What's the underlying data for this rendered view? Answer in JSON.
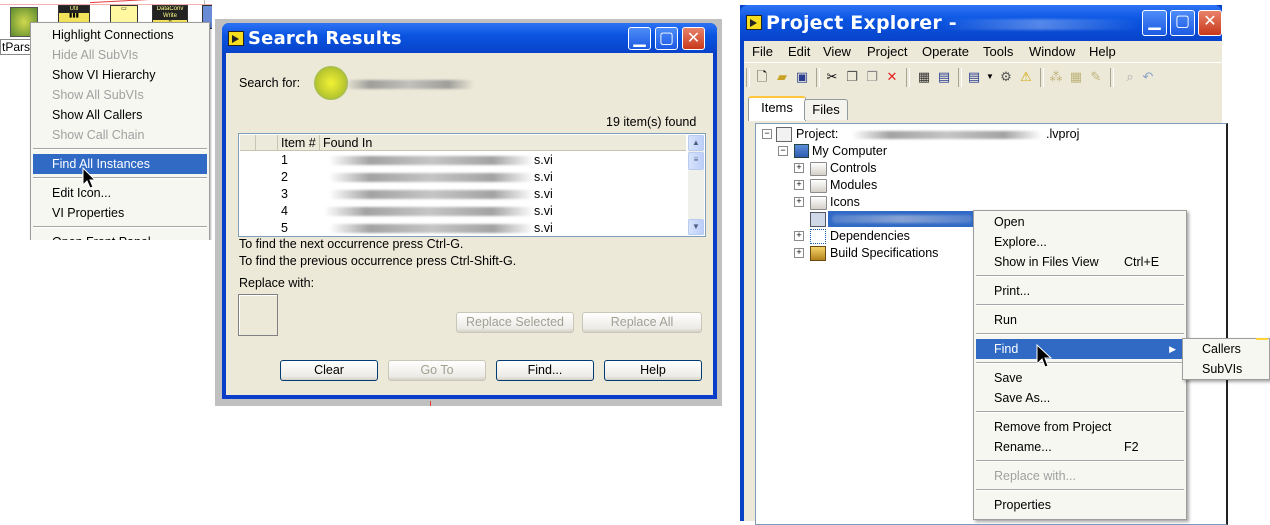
{
  "panel1": {
    "block_label": "tParse",
    "node_labels": [
      "Util",
      "DataConv Write"
    ],
    "context_menu": {
      "items": [
        {
          "label": "Highlight Connections",
          "disabled": false
        },
        {
          "label": "Hide All SubVIs",
          "disabled": true
        },
        {
          "label": "Show VI Hierarchy",
          "disabled": false
        },
        {
          "label": "Show All SubVIs",
          "disabled": true
        },
        {
          "label": "Show All Callers",
          "disabled": false
        },
        {
          "label": "Show Call Chain",
          "disabled": true
        },
        {
          "label": "Find All Instances",
          "selected": true
        },
        {
          "label": "Edit Icon...",
          "disabled": false
        },
        {
          "label": "VI Properties",
          "disabled": false
        },
        {
          "label": "Open Front Panel",
          "disabled": false
        }
      ]
    }
  },
  "search_results": {
    "title": "Search Results",
    "search_for_label": "Search for:",
    "count_text": "19 item(s) found",
    "columns": [
      "Item #",
      "Found In"
    ],
    "rows": [
      {
        "num": "1",
        "suffix": "s.vi"
      },
      {
        "num": "2",
        "suffix": "s.vi"
      },
      {
        "num": "3",
        "suffix": "s.vi"
      },
      {
        "num": "4",
        "suffix": "s.vi"
      },
      {
        "num": "5",
        "suffix": "s.vi"
      }
    ],
    "hint_next": "To find the next occurrence press Ctrl-G.",
    "hint_prev": "To find the previous occurrence press Ctrl-Shift-G.",
    "replace_label": "Replace with:",
    "buttons": {
      "replace_selected": "Replace Selected",
      "replace_all": "Replace All",
      "clear": "Clear",
      "goto": "Go To",
      "find": "Find...",
      "help": "Help"
    }
  },
  "project_explorer": {
    "title": "Project Explorer -",
    "menus": [
      "File",
      "Edit",
      "View",
      "Project",
      "Operate",
      "Tools",
      "Window",
      "Help"
    ],
    "tabs": [
      "Items",
      "Files"
    ],
    "tree": {
      "project_label": "Project:",
      "project_suffix": ".lvproj",
      "my_computer": "My Computer",
      "folders": [
        "Controls",
        "Modules",
        "Icons"
      ],
      "dependencies": "Dependencies",
      "build_specs": "Build Specifications"
    },
    "context_menu": {
      "open": "Open",
      "explore": "Explore...",
      "show_in_files": "Show in Files View",
      "show_in_files_shortcut": "Ctrl+E",
      "print": "Print...",
      "run": "Run",
      "find": "Find",
      "save": "Save",
      "save_as": "Save As...",
      "remove": "Remove from Project",
      "rename": "Rename...",
      "rename_shortcut": "F2",
      "replace_with": "Replace with...",
      "properties": "Properties"
    },
    "submenu": {
      "callers": "Callers",
      "subvis": "SubVIs"
    }
  },
  "colors": {
    "titlebar": "#0a55e2",
    "menu_highlight": "#316ac5",
    "wire": "#e23b3b",
    "node": "#f2e35a"
  }
}
